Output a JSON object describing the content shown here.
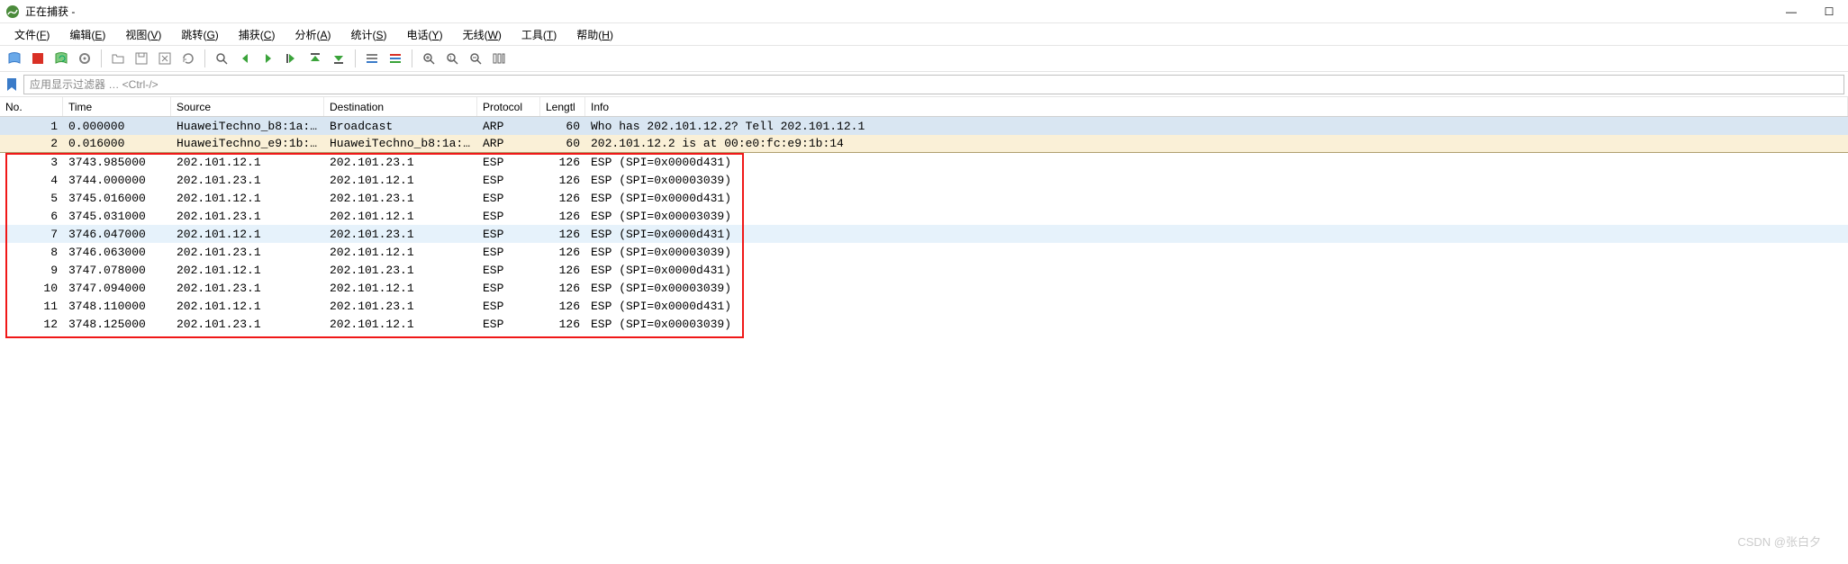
{
  "titlebar": {
    "title": "正在捕获 -"
  },
  "menu": {
    "file": {
      "label": "文件",
      "key": "F"
    },
    "edit": {
      "label": "编辑",
      "key": "E"
    },
    "view": {
      "label": "视图",
      "key": "V"
    },
    "go": {
      "label": "跳转",
      "key": "G"
    },
    "capture": {
      "label": "捕获",
      "key": "C"
    },
    "analyze": {
      "label": "分析",
      "key": "A"
    },
    "stats": {
      "label": "统计",
      "key": "S"
    },
    "telephony": {
      "label": "电话",
      "key": "Y"
    },
    "wireless": {
      "label": "无线",
      "key": "W"
    },
    "tools": {
      "label": "工具",
      "key": "T"
    },
    "help": {
      "label": "帮助",
      "key": "H"
    }
  },
  "filter": {
    "placeholder": "应用显示过滤器 … <Ctrl-/>"
  },
  "columns": {
    "no": "No.",
    "time": "Time",
    "src": "Source",
    "dst": "Destination",
    "proto": "Protocol",
    "len": "Lengtl",
    "info": "Info"
  },
  "rows": [
    {
      "no": 1,
      "time": "0.000000",
      "src": "HuaweiTechno_b8:1a:…",
      "dst": "Broadcast",
      "proto": "ARP",
      "len": 60,
      "info": "Who has 202.101.12.2? Tell 202.101.12.1",
      "cls": "row-arp1"
    },
    {
      "no": 2,
      "time": "0.016000",
      "src": "HuaweiTechno_e9:1b:…",
      "dst": "HuaweiTechno_b8:1a:…",
      "proto": "ARP",
      "len": 60,
      "info": "202.101.12.2 is at 00:e0:fc:e9:1b:14",
      "cls": "row-arp2"
    },
    {
      "no": 3,
      "time": "3743.985000",
      "src": "202.101.12.1",
      "dst": "202.101.23.1",
      "proto": "ESP",
      "len": 126,
      "info": "ESP (SPI=0x0000d431)",
      "cls": "row-esp"
    },
    {
      "no": 4,
      "time": "3744.000000",
      "src": "202.101.23.1",
      "dst": "202.101.12.1",
      "proto": "ESP",
      "len": 126,
      "info": "ESP (SPI=0x00003039)",
      "cls": "row-esp"
    },
    {
      "no": 5,
      "time": "3745.016000",
      "src": "202.101.12.1",
      "dst": "202.101.23.1",
      "proto": "ESP",
      "len": 126,
      "info": "ESP (SPI=0x0000d431)",
      "cls": "row-esp"
    },
    {
      "no": 6,
      "time": "3745.031000",
      "src": "202.101.23.1",
      "dst": "202.101.12.1",
      "proto": "ESP",
      "len": 126,
      "info": "ESP (SPI=0x00003039)",
      "cls": "row-esp"
    },
    {
      "no": 7,
      "time": "3746.047000",
      "src": "202.101.12.1",
      "dst": "202.101.23.1",
      "proto": "ESP",
      "len": 126,
      "info": "ESP (SPI=0x0000d431)",
      "cls": "row-sel"
    },
    {
      "no": 8,
      "time": "3746.063000",
      "src": "202.101.23.1",
      "dst": "202.101.12.1",
      "proto": "ESP",
      "len": 126,
      "info": "ESP (SPI=0x00003039)",
      "cls": "row-esp"
    },
    {
      "no": 9,
      "time": "3747.078000",
      "src": "202.101.12.1",
      "dst": "202.101.23.1",
      "proto": "ESP",
      "len": 126,
      "info": "ESP (SPI=0x0000d431)",
      "cls": "row-esp"
    },
    {
      "no": 10,
      "time": "3747.094000",
      "src": "202.101.23.1",
      "dst": "202.101.12.1",
      "proto": "ESP",
      "len": 126,
      "info": "ESP (SPI=0x00003039)",
      "cls": "row-esp"
    },
    {
      "no": 11,
      "time": "3748.110000",
      "src": "202.101.12.1",
      "dst": "202.101.23.1",
      "proto": "ESP",
      "len": 126,
      "info": "ESP (SPI=0x0000d431)",
      "cls": "row-esp"
    },
    {
      "no": 12,
      "time": "3748.125000",
      "src": "202.101.23.1",
      "dst": "202.101.12.1",
      "proto": "ESP",
      "len": 126,
      "info": "ESP (SPI=0x00003039)",
      "cls": "row-esp"
    }
  ],
  "watermark": "CSDN @张白夕"
}
